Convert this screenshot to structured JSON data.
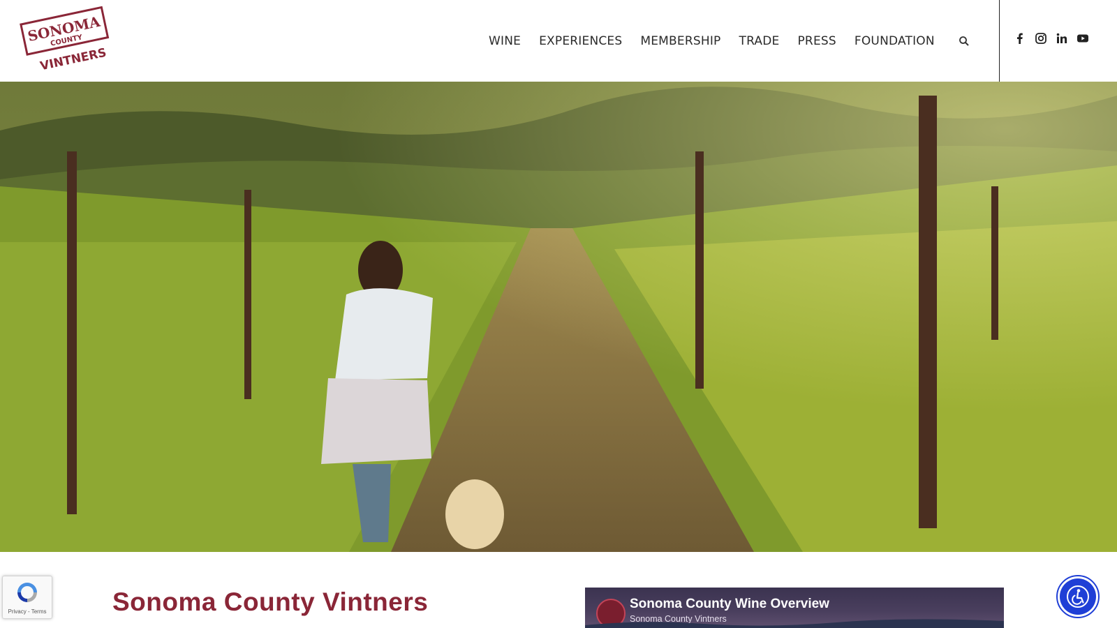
{
  "logo": {
    "line1": "SONOMA",
    "line2": "COUNTY",
    "line3": "VINTNERS"
  },
  "nav": {
    "items": [
      {
        "label": "WINE"
      },
      {
        "label": "EXPERIENCES"
      },
      {
        "label": "MEMBERSHIP"
      },
      {
        "label": "TRADE"
      },
      {
        "label": "PRESS"
      },
      {
        "label": "FOUNDATION"
      }
    ],
    "search_icon": "search-icon"
  },
  "social": [
    "facebook-icon",
    "instagram-icon",
    "linkedin-icon",
    "youtube-icon"
  ],
  "hero": {
    "image": "vineyard-row-with-woman-and-dog"
  },
  "main": {
    "title": "Sonoma County Vintners"
  },
  "video": {
    "title": "Sonoma County Wine Overview",
    "channel": "Sonoma County Vintners"
  },
  "recaptcha": {
    "text": "Privacy - Terms"
  },
  "accessibility": {
    "icon": "accessibility-icon"
  },
  "colors": {
    "brand": "#8a2637",
    "nav_text": "#2a2a2a",
    "accessibility": "#1f3fd6"
  }
}
